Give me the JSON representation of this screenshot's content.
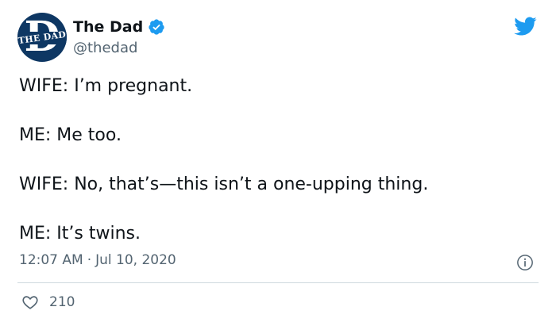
{
  "author": {
    "display_name": "The Dad",
    "handle": "@thedad",
    "avatar_text": "THE DAD",
    "avatar_letter": "D",
    "verified": true
  },
  "tweet": {
    "lines": [
      "WIFE: I’m pregnant.",
      "ME: Me too.",
      "WIFE: No, that’s—this isn’t a one-upping thing.",
      "ME: It’s twins."
    ],
    "time": "12:07 AM",
    "separator": "·",
    "date": "Jul 10, 2020",
    "like_count": "210"
  },
  "icons": {
    "platform": "twitter-bird-icon",
    "verified": "verified-badge-icon",
    "info": "info-icon",
    "like": "heart-icon"
  },
  "colors": {
    "brand_blue": "#1d9bf0",
    "avatar_navy": "#0e3763",
    "text": "#0f1419",
    "muted": "#536471",
    "divider": "#cfd9de"
  }
}
